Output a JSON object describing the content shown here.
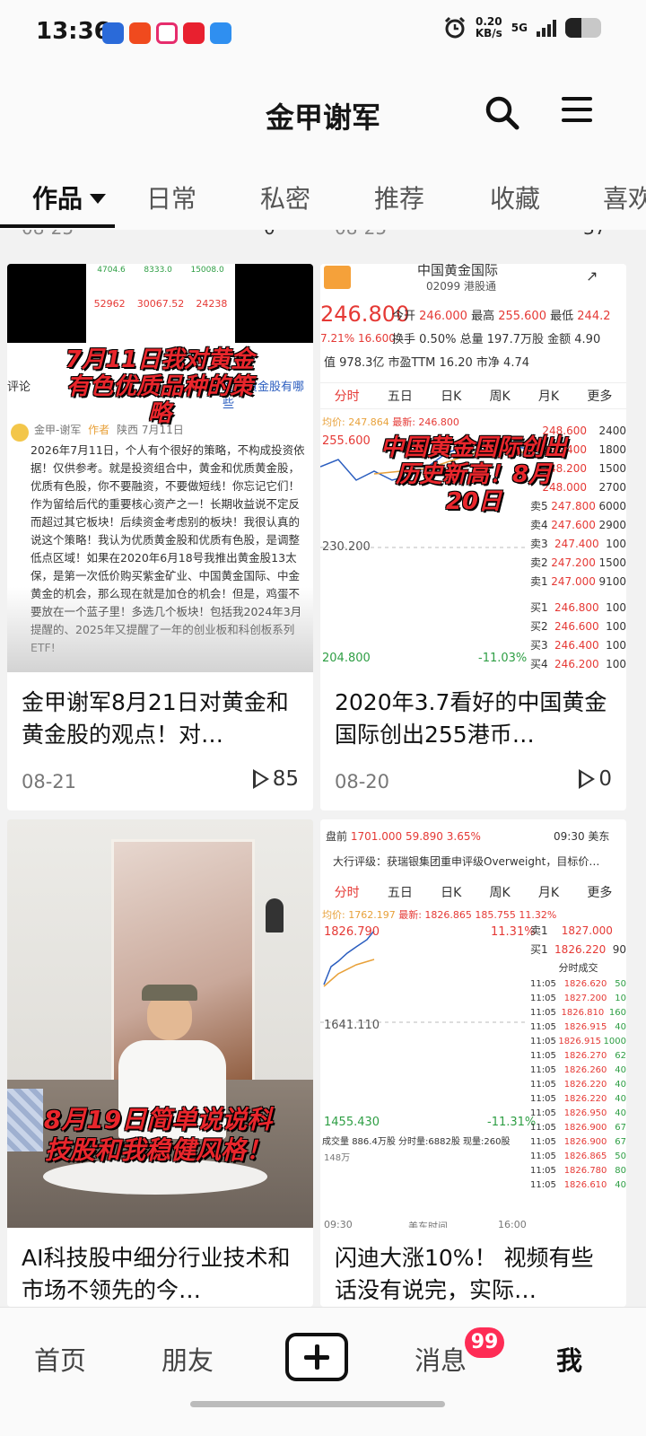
{
  "status_bar": {
    "time": "13:36",
    "speed_value": "0.20",
    "speed_unit": "KB/s",
    "network": "5G",
    "battery_level": 0.45
  },
  "header": {
    "title": "金甲谢军",
    "search_icon": "search-icon",
    "menu_icon": "menu-icon"
  },
  "tabs": [
    {
      "label": "作品"
    },
    {
      "label": "日常"
    },
    {
      "label": "私密"
    },
    {
      "label": "推荐"
    },
    {
      "label": "收藏"
    },
    {
      "label": "喜欢"
    }
  ],
  "prev_row": {
    "left_date": "08-25",
    "left_plays": "0",
    "right_date": "08-25",
    "right_plays": "37"
  },
  "videos": [
    {
      "title": "金甲谢军8月21日对黄金和黄金股的观点！对…",
      "date": "08-21",
      "plays": "85",
      "overlay": "7月11日我对黄金有色优质品种的策略",
      "thumb_header_nums": [
        "4704.6",
        "8333.0",
        "15008.0"
      ],
      "thumb_table": [
        "52962",
        "30067.52",
        "24238"
      ],
      "thumb_label": "评论",
      "thumb_link": "优质黄金股有哪些",
      "thumb_author": "金甲-谢军",
      "thumb_author_tag": "作者",
      "thumb_location": "陕西 7月11日",
      "thumb_text": "2026年7月11日，个人有个很好的策略，不构成投资依据！仅供参考。就是投资组合中，黄金和优质黄金股，优质有色股，你不要融资，不要做短线！你忘记它们！作为留给后代的重要核心资产之一！长期收益说不定反而超过其它板块！后续资金考虑别的板块！我很认真的说这个策略！我认为优质黄金股和优质有色股，是调整低点区域！如果在2020年6月18号我推出黄金股13太保，是第一次低价购买紫金矿业、中国黄金国际、中金黄金的机会，那么现在就是加仓的机会！但是，鸡蛋不要放在一个蓝子里！多选几个板块！包括我2024年3月提醒的、2025年又提醒了一年的创业板和科创板系列ETF!"
    },
    {
      "title": "2020年3.7看好的中国黄金国际创出255港币…",
      "date": "08-20",
      "plays": "0",
      "overlay": "中国黄金国际创出历史新高！8月20日",
      "stock_name": "中国黄金国际",
      "stock_code": "02099",
      "market": "港股通",
      "price": "246.800",
      "change_pct": "7.21%",
      "change_amt": "16.600",
      "open_label": "今开",
      "open": "246.000",
      "high_label": "最高",
      "high": "255.600",
      "low_label": "最低",
      "low": "244.2",
      "turnover_label": "换手",
      "turnover": "0.50%",
      "volume_label": "总量",
      "volume": "197.7万股",
      "amount_label": "金额",
      "amount": "4.90",
      "mcap_label": "值",
      "mcap": "978.3亿",
      "pe_label": "市盈TTM",
      "pe": "16.20",
      "pb_label": "市净",
      "pb": "4.74",
      "more": "更多",
      "chart_tabs": [
        "分时",
        "五日",
        "日K",
        "周K",
        "月K",
        "更多"
      ],
      "avg_label": "均价",
      "avg": "247.864",
      "latest_label": "最新",
      "latest": "246.800",
      "axis_hi": "255.600",
      "axis_mid": "230.200",
      "axis_lo": "204.800",
      "axis_neg": "-11.03%",
      "sell": [
        [
          "卖5",
          "247.800"
        ],
        [
          "卖4",
          "247.600"
        ],
        [
          "卖3",
          "247.400"
        ],
        [
          "卖2",
          "247.200"
        ],
        [
          "卖1",
          "247.000"
        ]
      ],
      "sell_vol": [
        "6000",
        "2900",
        "100",
        "1500",
        "9100"
      ],
      "buy": [
        [
          "买1",
          "246.800"
        ],
        [
          "买2",
          "246.600"
        ],
        [
          "买3",
          "246.400"
        ],
        [
          "买4",
          "246.200"
        ],
        [
          "买5",
          "246.000"
        ],
        [
          "买6",
          "245.800"
        ]
      ],
      "buy_vol": [
        "100",
        "100",
        "100",
        "100",
        "300",
        "2000"
      ],
      "upper_prices": [
        "248.600",
        "248.400",
        "248.200",
        "248.000"
      ],
      "upper_vols": [
        "2400",
        "1800",
        "1500",
        "2700"
      ]
    },
    {
      "title": "AI科技股中细分行业技术和市场不领先的今…",
      "date": "",
      "plays": "",
      "overlay": "8月19日简单说说科技股和我稳健风格！"
    },
    {
      "title": "闪迪大涨10%！ 视频有些话没有说完，实际…",
      "date": "",
      "plays": "",
      "pre_label": "盘前",
      "pre_price": "1701.000",
      "pre_chg": "59.890",
      "pre_pct": "3.65%",
      "time_label": "09:30 美东",
      "rating": "大行评级：获瑞银集团重申评级Overweight，目标价…",
      "chart_tabs": [
        "分时",
        "五日",
        "日K",
        "周K",
        "月K",
        "更多"
      ],
      "avg_label": "均价",
      "avg": "1762.197",
      "latest_label": "最新",
      "latest": "1826.865",
      "chg": "185.755",
      "pct": "11.32%",
      "axis_hi": "1826.790",
      "axis_hi_pct": "11.31%",
      "axis_mid": "1641.110",
      "axis_lo": "1455.430",
      "axis_lo_pct": "-11.31%",
      "sell1_label": "卖1",
      "sell1": "1827.000",
      "buy1_label": "买1",
      "buy1": "1826.220",
      "buy1_vol": "90",
      "trades_title": "分时成交",
      "trades": [
        [
          "11:05",
          "1826.620",
          "50"
        ],
        [
          "11:05",
          "1827.200",
          "10"
        ],
        [
          "11:05",
          "1826.810",
          "160"
        ],
        [
          "11:05",
          "1826.915",
          "40"
        ],
        [
          "11:05",
          "1826.915",
          "1000"
        ],
        [
          "11:05",
          "1826.270",
          "62"
        ],
        [
          "11:05",
          "1826.260",
          "40"
        ],
        [
          "11:05",
          "1826.220",
          "40"
        ],
        [
          "11:05",
          "1826.220",
          "40"
        ],
        [
          "11:05",
          "1826.950",
          "40"
        ],
        [
          "11:05",
          "1826.900",
          "67"
        ],
        [
          "11:05",
          "1826.900",
          "67"
        ],
        [
          "11:05",
          "1826.865",
          "50"
        ],
        [
          "11:05",
          "1826.780",
          "80"
        ],
        [
          "11:05",
          "1826.610",
          "40"
        ]
      ],
      "volume_label": "成交量",
      "volume": "886.4万股",
      "deal_label": "分时量:6882股",
      "now_label": "现量:260股",
      "vol_axis": "148万",
      "t_start": "09:30",
      "t_mid": "美东时间",
      "t_end": "16:00"
    }
  ],
  "bottom_nav": {
    "home": "首页",
    "friends": "朋友",
    "messages": "消息",
    "badge": "99",
    "me": "我"
  },
  "colors": {
    "accent": "#fe2c55",
    "up": "#e53935",
    "down": "#2e9e44"
  }
}
